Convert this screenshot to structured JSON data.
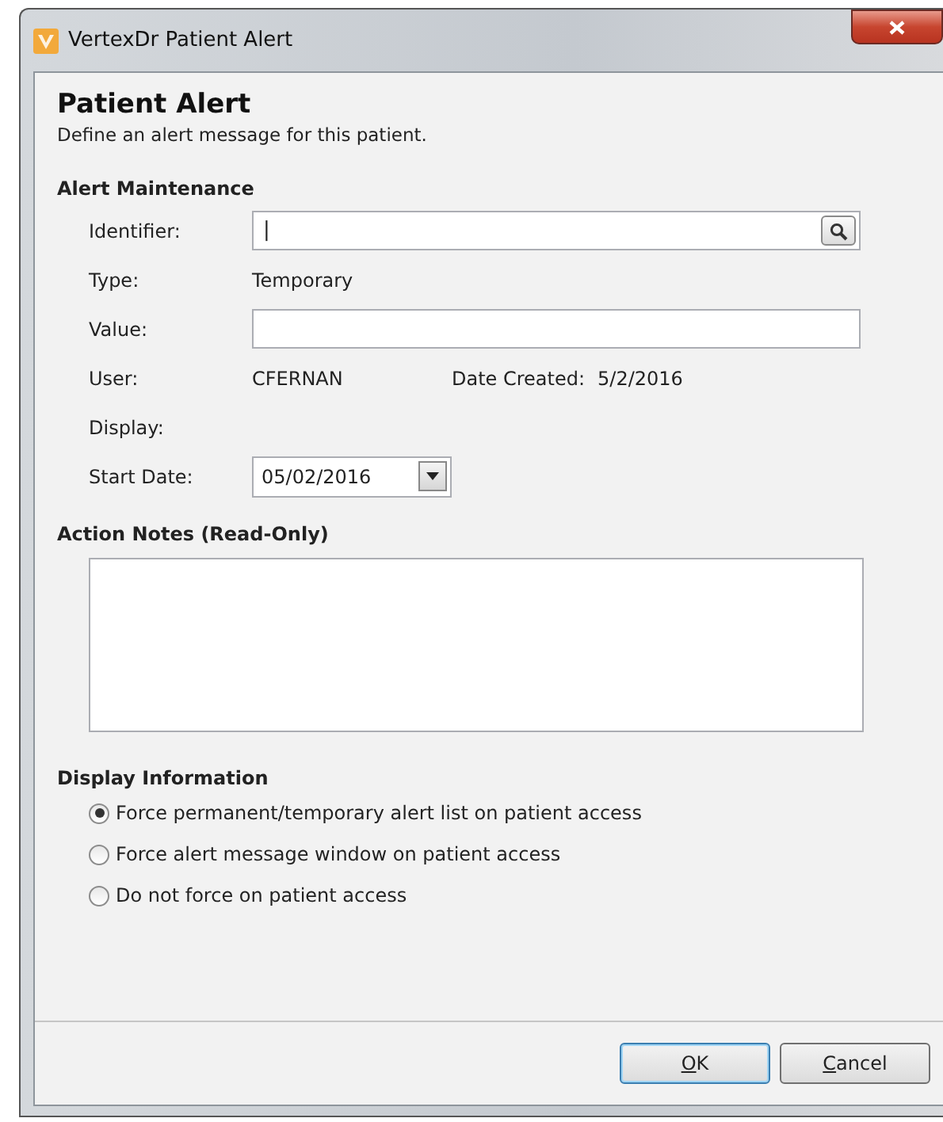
{
  "window": {
    "title": "VertexDr Patient Alert"
  },
  "header": {
    "title": "Patient Alert",
    "subtitle": "Define an alert message for this patient."
  },
  "alert_maintenance": {
    "heading": "Alert Maintenance",
    "identifier": {
      "label": "Identifier:",
      "value": "|"
    },
    "type": {
      "label": "Type:",
      "value": "Temporary"
    },
    "value": {
      "label": "Value:"
    },
    "user": {
      "label": "User:",
      "value": "CFERNAN",
      "date_label": "Date Created:",
      "date_value": "5/2/2016"
    },
    "display": {
      "label": "Display:"
    },
    "start_date": {
      "label": "Start Date:",
      "value": "05/02/2016"
    }
  },
  "action_notes": {
    "heading": "Action Notes (Read-Only)"
  },
  "display_information": {
    "heading": "Display Information",
    "options": [
      {
        "label": "Force permanent/temporary alert list on patient access",
        "selected": true
      },
      {
        "label": "Force alert message window on patient access",
        "selected": false
      },
      {
        "label": "Do not force on patient access",
        "selected": false
      }
    ]
  },
  "buttons": [
    {
      "label": "OK",
      "default": true
    },
    {
      "label": "Cancel",
      "default": false
    }
  ]
}
